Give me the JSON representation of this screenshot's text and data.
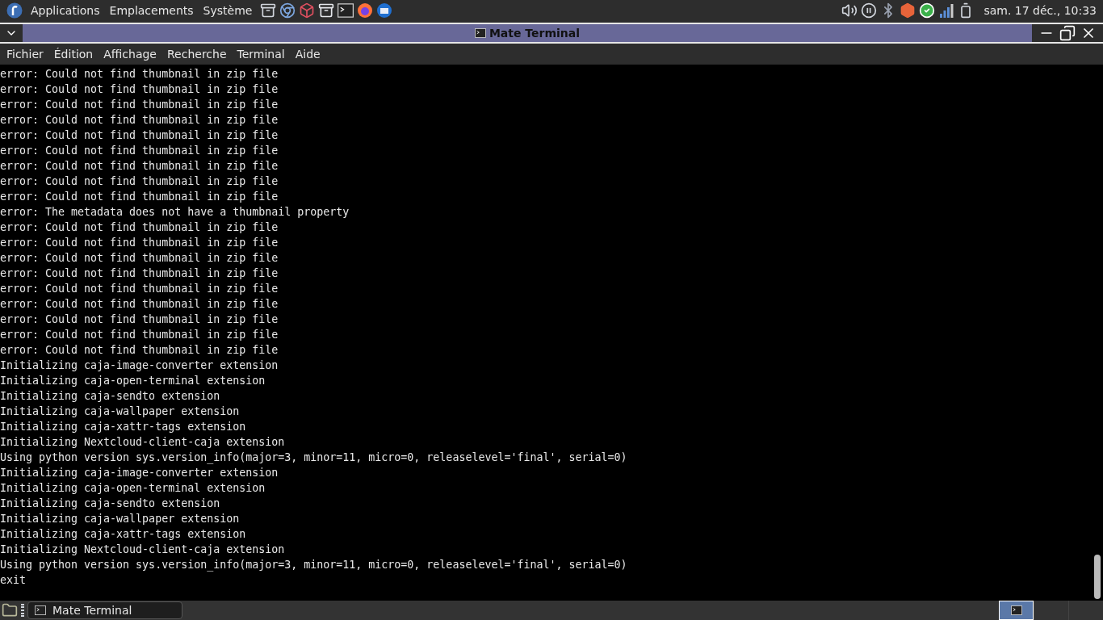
{
  "top_panel": {
    "menus": [
      "Applications",
      "Emplacements",
      "Système"
    ],
    "clock": "sam. 17 déc., 10:33"
  },
  "window": {
    "title": "Mate Terminal"
  },
  "menubar": [
    "Fichier",
    "Édition",
    "Affichage",
    "Recherche",
    "Terminal",
    "Aide"
  ],
  "terminal": {
    "lines": [
      "error: Could not find thumbnail in zip file",
      "error: Could not find thumbnail in zip file",
      "error: Could not find thumbnail in zip file",
      "error: Could not find thumbnail in zip file",
      "error: Could not find thumbnail in zip file",
      "error: Could not find thumbnail in zip file",
      "error: Could not find thumbnail in zip file",
      "error: Could not find thumbnail in zip file",
      "error: Could not find thumbnail in zip file",
      "error: The metadata does not have a thumbnail property",
      "error: Could not find thumbnail in zip file",
      "error: Could not find thumbnail in zip file",
      "error: Could not find thumbnail in zip file",
      "error: Could not find thumbnail in zip file",
      "error: Could not find thumbnail in zip file",
      "error: Could not find thumbnail in zip file",
      "error: Could not find thumbnail in zip file",
      "error: Could not find thumbnail in zip file",
      "error: Could not find thumbnail in zip file",
      "Initializing caja-image-converter extension",
      "Initializing caja-open-terminal extension",
      "Initializing caja-sendto extension",
      "Initializing caja-wallpaper extension",
      "Initializing caja-xattr-tags extension",
      "Initializing Nextcloud-client-caja extension",
      "Using python version sys.version_info(major=3, minor=11, micro=0, releaselevel='final', serial=0)",
      "Initializing caja-image-converter extension",
      "Initializing caja-open-terminal extension",
      "Initializing caja-sendto extension",
      "Initializing caja-wallpaper extension",
      "Initializing caja-xattr-tags extension",
      "Initializing Nextcloud-client-caja extension",
      "Using python version sys.version_info(major=3, minor=11, micro=0, releaselevel='final', serial=0)",
      "exit"
    ]
  },
  "bottom_panel": {
    "tasks": [
      {
        "label": "Mate Terminal",
        "selected": false
      }
    ],
    "workspaces": [
      {
        "selected": true
      },
      {
        "selected": false
      },
      {
        "selected": false
      }
    ]
  }
}
